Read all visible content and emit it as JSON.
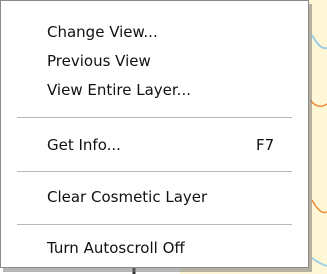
{
  "context_menu": {
    "groups": [
      [
        {
          "label": "Change View..."
        },
        {
          "label": "Previous View"
        },
        {
          "label": "View Entire Layer..."
        }
      ],
      [
        {
          "label": "Get Info...",
          "shortcut": "F7"
        }
      ],
      [
        {
          "label": "Clear Cosmetic Layer"
        }
      ],
      [
        {
          "label": "Turn Autoscroll Off"
        }
      ]
    ]
  },
  "colors": {
    "menu_background": "#ffffff",
    "menu_border": "#8a8a8a",
    "separator": "#b8b8b8",
    "map_background": "#fff7d6",
    "map_road": "#f08c3c",
    "map_water": "#9fd0e8"
  }
}
